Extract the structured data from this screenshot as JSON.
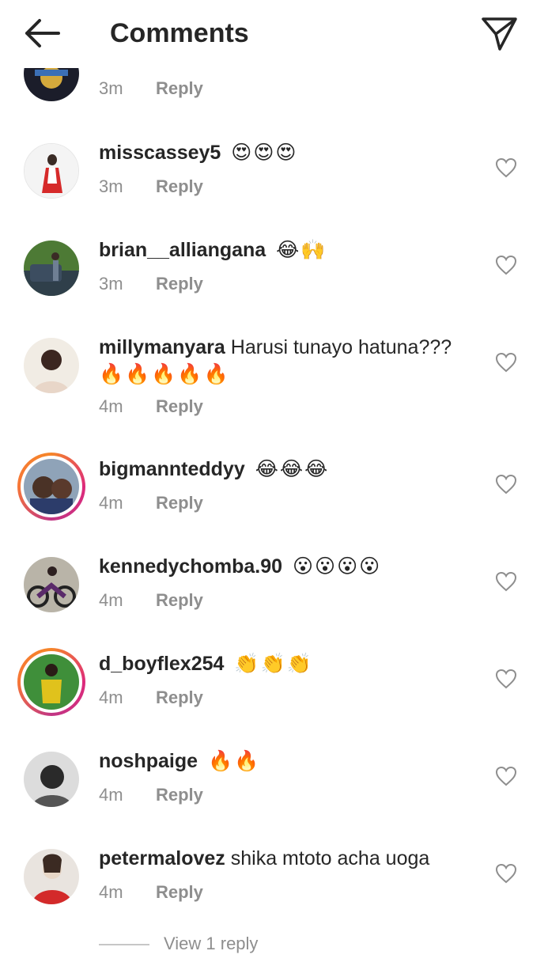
{
  "header": {
    "title": "Comments"
  },
  "top_partial": {
    "time": "3m",
    "reply": "Reply"
  },
  "comments": [
    {
      "user": "misscassey5",
      "text": "",
      "emoji": "😍😍😍",
      "time": "3m",
      "reply": "Reply"
    },
    {
      "user": "brian__alliangana",
      "text": "",
      "emoji": "😂🙌",
      "time": "3m",
      "reply": "Reply"
    },
    {
      "user": "millymanyara",
      "text": "Harusi tunayo hatuna???",
      "emoji": "🔥🔥🔥🔥🔥",
      "time": "4m",
      "reply": "Reply"
    },
    {
      "user": "bigmannteddyy",
      "text": "",
      "emoji": "😂😂😂",
      "time": "4m",
      "reply": "Reply"
    },
    {
      "user": "kennedychomba.90",
      "text": "",
      "emoji": "😮😮😮😮",
      "time": "4m",
      "reply": "Reply"
    },
    {
      "user": "d_boyflex254",
      "text": "",
      "emoji": "👏👏👏",
      "time": "4m",
      "reply": "Reply"
    },
    {
      "user": "noshpaige",
      "text": "",
      "emoji": "🔥🔥",
      "time": "4m",
      "reply": "Reply"
    },
    {
      "user": "petermalovez",
      "text": "shika mtoto acha  uoga",
      "emoji": "",
      "time": "4m",
      "reply": "Reply"
    }
  ],
  "view_replies": "View 1 reply",
  "colors": {
    "text": "#262626",
    "secondary": "#8e8e8e",
    "story_ring": "#dd2a7b"
  }
}
